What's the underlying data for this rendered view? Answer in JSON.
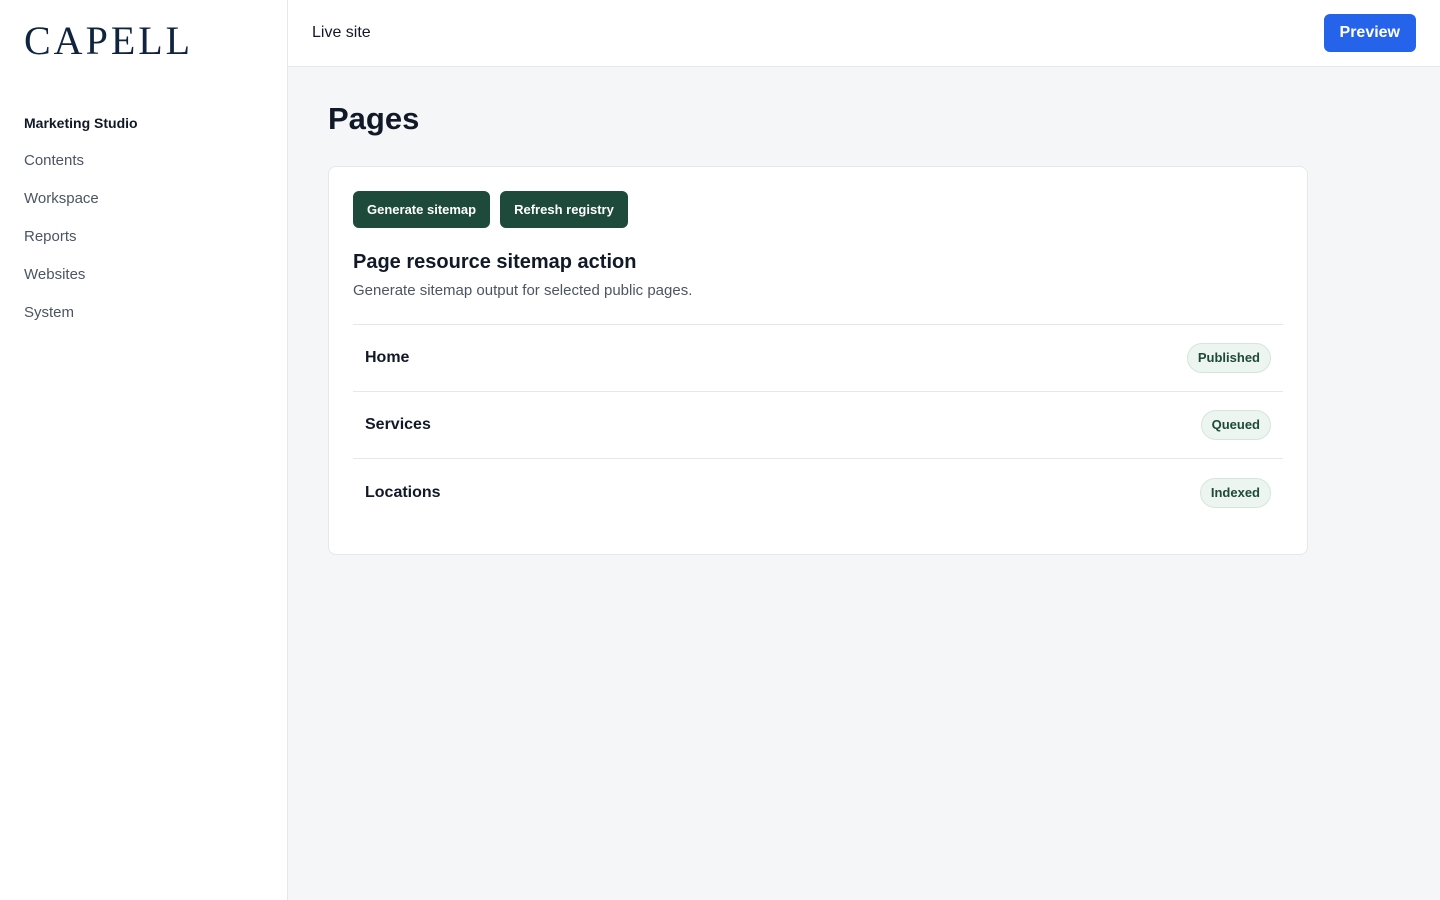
{
  "brand": {
    "logo_text": "CAPELL"
  },
  "sidebar": {
    "heading": "Marketing Studio",
    "items": [
      {
        "label": "Contents"
      },
      {
        "label": "Workspace"
      },
      {
        "label": "Reports"
      },
      {
        "label": "Websites"
      },
      {
        "label": "System"
      }
    ]
  },
  "topbar": {
    "live_site_label": "Live site",
    "preview_label": "Preview"
  },
  "page": {
    "title": "Pages"
  },
  "card": {
    "actions": [
      {
        "label": "Generate sitemap"
      },
      {
        "label": "Refresh registry"
      }
    ],
    "title": "Page resource sitemap action",
    "description": "Generate sitemap output for selected public pages.",
    "rows": [
      {
        "name": "Home",
        "status": "Published"
      },
      {
        "name": "Services",
        "status": "Queued"
      },
      {
        "name": "Locations",
        "status": "Indexed"
      }
    ]
  },
  "colors": {
    "accent_blue": "#2563eb",
    "action_green": "#1e4a3b",
    "badge_bg": "#ecf5ef",
    "logo_navy": "#10243f"
  }
}
